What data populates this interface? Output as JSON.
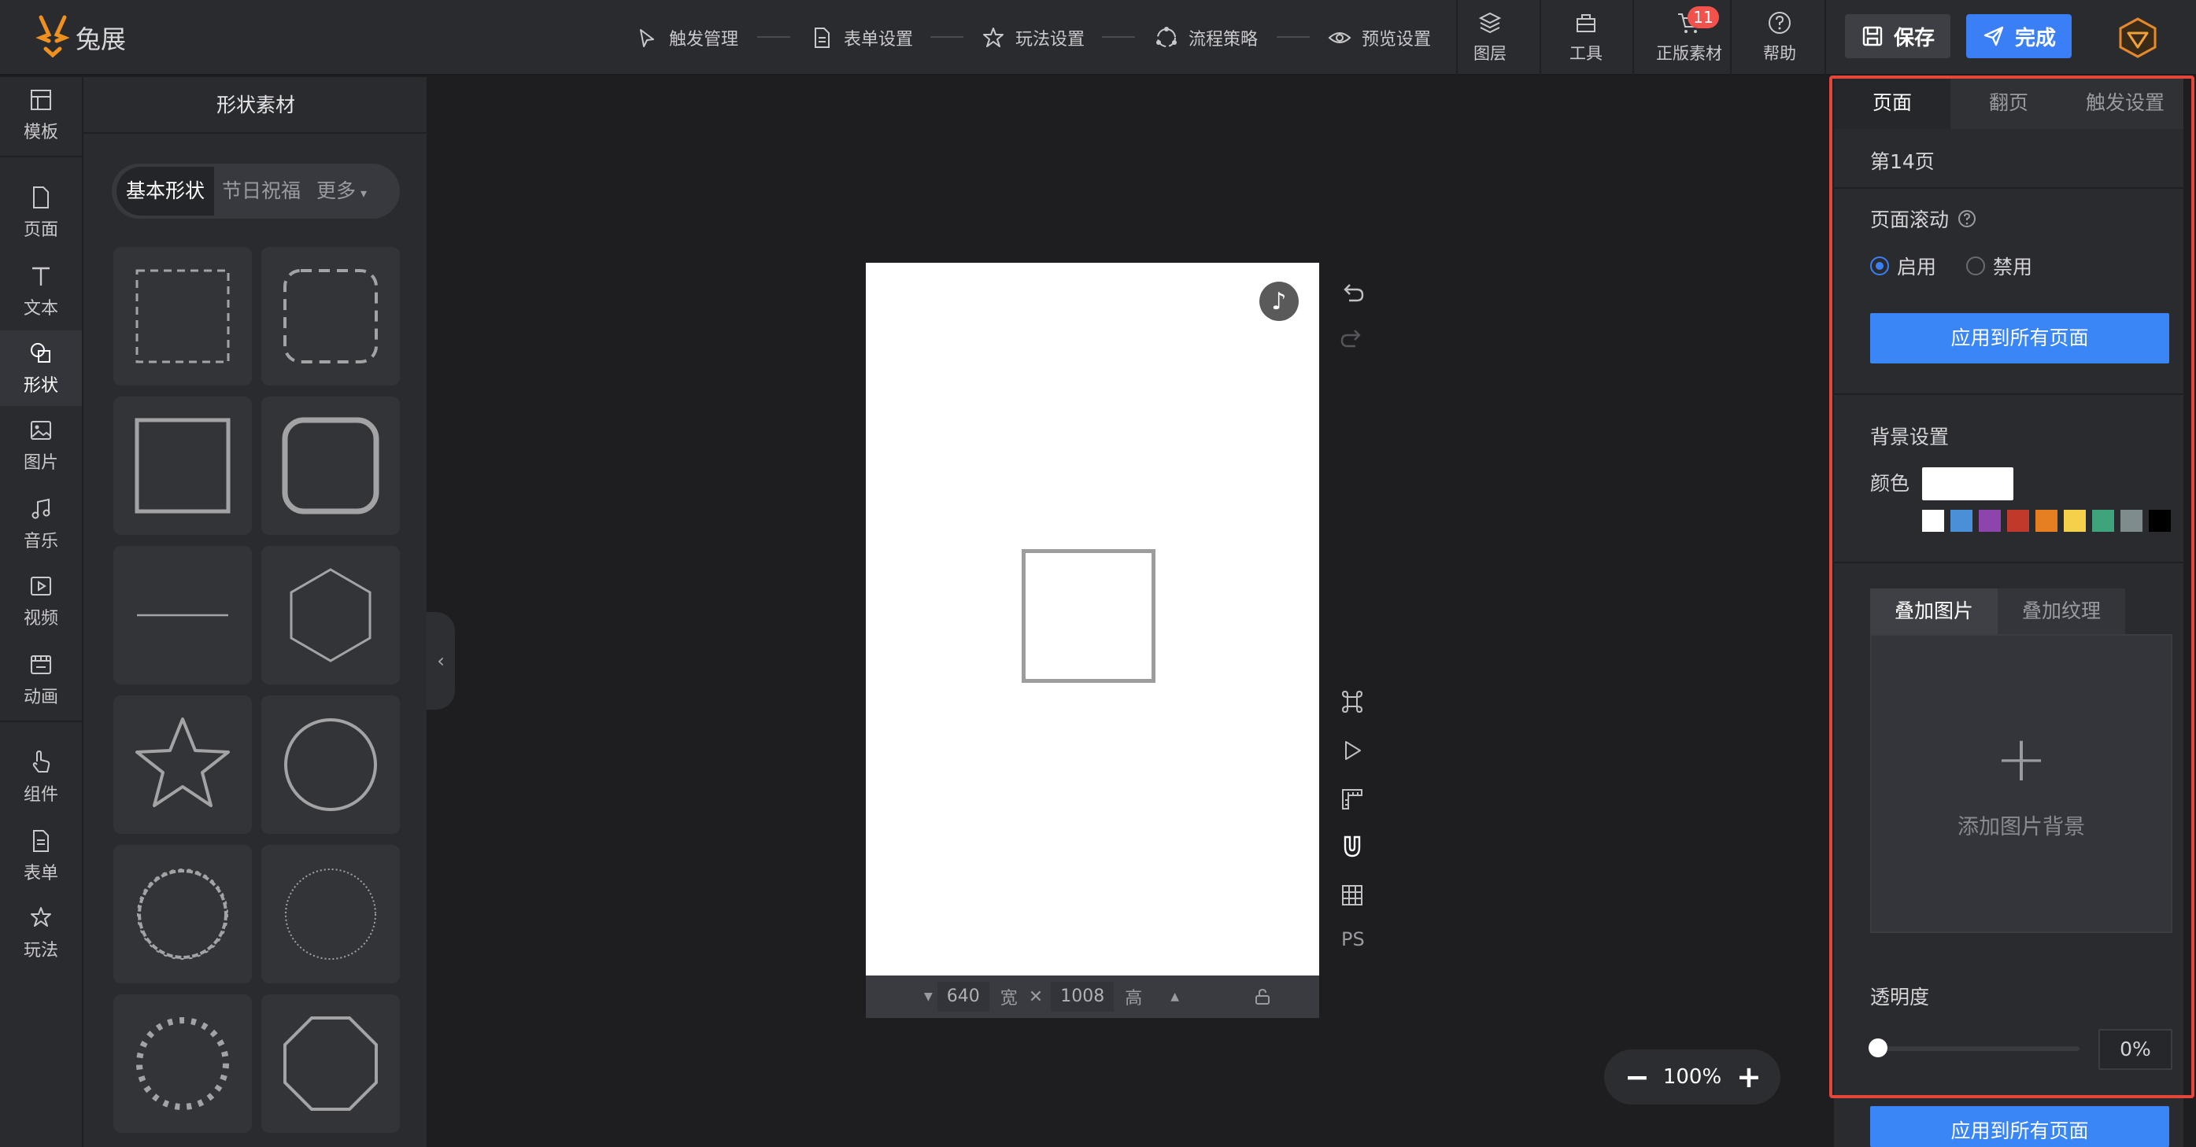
{
  "brand": {
    "name": "兔展",
    "color": "#f0901f"
  },
  "steps": [
    {
      "label": "触发管理",
      "icon": "cursor-tap-icon"
    },
    {
      "label": "表单设置",
      "icon": "document-icon"
    },
    {
      "label": "玩法设置",
      "icon": "star-hand-icon"
    },
    {
      "label": "流程策略",
      "icon": "flow-icon"
    },
    {
      "label": "预览设置",
      "icon": "eye-icon"
    }
  ],
  "tools": [
    {
      "label": "图层",
      "icon": "layers-icon"
    },
    {
      "label": "工具",
      "icon": "toolbox-icon"
    },
    {
      "label": "正版素材",
      "icon": "cart-icon",
      "badge": "11"
    },
    {
      "label": "帮助",
      "icon": "help-icon"
    }
  ],
  "buttons": {
    "save": "保存",
    "done": "完成"
  },
  "rail": [
    {
      "label": "模板",
      "icon": "template-icon"
    },
    {
      "label": "页面",
      "icon": "page-icon"
    },
    {
      "label": "文本",
      "icon": "text-icon"
    },
    {
      "label": "形状",
      "icon": "shape-icon",
      "active": true
    },
    {
      "label": "图片",
      "icon": "image-icon"
    },
    {
      "label": "音乐",
      "icon": "music-icon"
    },
    {
      "label": "视频",
      "icon": "video-icon"
    },
    {
      "label": "动画",
      "icon": "animation-icon"
    },
    {
      "label": "组件",
      "icon": "component-icon"
    },
    {
      "label": "表单",
      "icon": "form-icon"
    },
    {
      "label": "玩法",
      "icon": "play-icon"
    }
  ],
  "panel": {
    "title": "形状素材",
    "tabs": [
      "基本形状",
      "节日祝福",
      "更多"
    ],
    "shapes": [
      "dashed-square",
      "dashed-rounded-square",
      "square",
      "rounded-square",
      "line",
      "hexagon",
      "star",
      "circle",
      "wavy-circle",
      "dotted-circle",
      "beaded-circle",
      "octagon"
    ]
  },
  "canvas": {
    "width": "640",
    "width_unit": "宽",
    "height": "1008",
    "height_unit": "高",
    "zoom": "100%",
    "ps_label": "PS",
    "music_glyph": "♪"
  },
  "props": {
    "tabs": [
      "页面",
      "翻页",
      "触发设置"
    ],
    "page_number": "第14页",
    "scroll_label": "页面滚动",
    "scroll_options": [
      "启用",
      "禁用"
    ],
    "apply_all": "应用到所有页面",
    "bg_title": "背景设置",
    "color_label": "颜色",
    "current_color": "#ffffff",
    "palette": [
      "#ffffff",
      "#4a90d9",
      "#8e44ad",
      "#c0392b",
      "#e67e22",
      "#f5d04a",
      "#3fa37b",
      "#7f8c8d",
      "#000000"
    ],
    "subtabs": [
      "叠加图片",
      "叠加纹理"
    ],
    "add_bg": "添加图片背景",
    "opacity_label": "透明度",
    "opacity": "0%"
  }
}
